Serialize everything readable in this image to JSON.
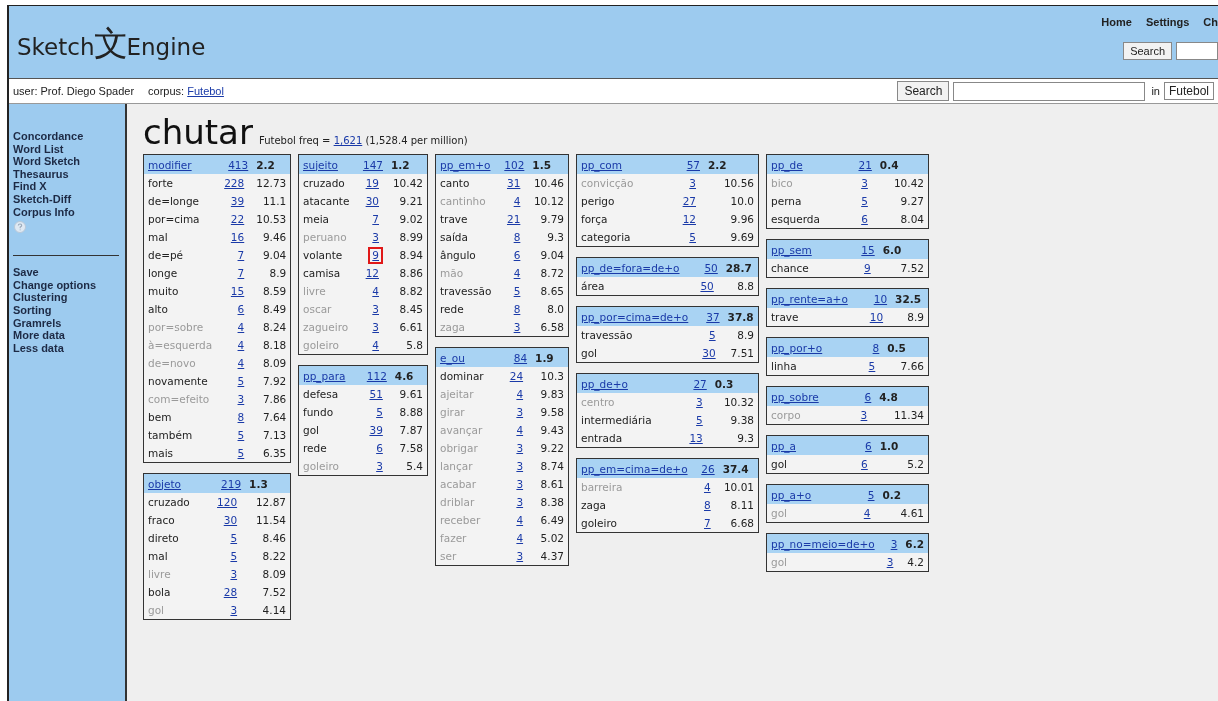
{
  "header": {
    "logo": {
      "left": "Sketch",
      "glyph": "文",
      "right": "Engine"
    },
    "nav_links": [
      "Home",
      "Settings",
      "Ch"
    ],
    "search_button": "Search"
  },
  "user_bar": {
    "user_label": "user:",
    "user": "Prof. Diego Spader",
    "corpus_label": "corpus:",
    "corpus": "Futebol",
    "search_button": "Search",
    "in_label": "in",
    "corpus_select": "Futebol"
  },
  "sidebar": {
    "groups": [
      [
        "Concordance",
        "Word List",
        "Word Sketch",
        "Thesaurus",
        "Find X",
        "Sketch-Diff",
        "Corpus Info"
      ],
      [
        "Save",
        "Change options",
        "Clustering",
        "Sorting",
        "Gramrels",
        "More data",
        "Less data"
      ]
    ]
  },
  "main": {
    "headword": "chutar",
    "freq_prefix": "Futebol freq = ",
    "freq": "1,621",
    "freq_suffix": " (1,528.4 per million)",
    "columns": [
      [
        {
          "relation": "modifier",
          "count": "413",
          "score": "2.2",
          "rows": [
            {
              "word": "forte",
              "count": "228",
              "score": "12.73",
              "dimmed": false,
              "marked": false
            },
            {
              "word": "de=longe",
              "count": "39",
              "score": "11.1",
              "dimmed": false,
              "marked": false
            },
            {
              "word": "por=cima",
              "count": "22",
              "score": "10.53",
              "dimmed": false,
              "marked": false
            },
            {
              "word": "mal",
              "count": "16",
              "score": "9.46",
              "dimmed": false,
              "marked": false
            },
            {
              "word": "de=pé",
              "count": "7",
              "score": "9.04",
              "dimmed": false,
              "marked": false
            },
            {
              "word": "longe",
              "count": "7",
              "score": "8.9",
              "dimmed": false,
              "marked": false
            },
            {
              "word": "muito",
              "count": "15",
              "score": "8.59",
              "dimmed": false,
              "marked": false
            },
            {
              "word": "alto",
              "count": "6",
              "score": "8.49",
              "dimmed": false,
              "marked": false
            },
            {
              "word": "por=sobre",
              "count": "4",
              "score": "8.24",
              "dimmed": true,
              "marked": false
            },
            {
              "word": "à=esquerda",
              "count": "4",
              "score": "8.18",
              "dimmed": true,
              "marked": false
            },
            {
              "word": "de=novo",
              "count": "4",
              "score": "8.09",
              "dimmed": true,
              "marked": false
            },
            {
              "word": "novamente",
              "count": "5",
              "score": "7.92",
              "dimmed": false,
              "marked": false
            },
            {
              "word": "com=efeito",
              "count": "3",
              "score": "7.86",
              "dimmed": true,
              "marked": false
            },
            {
              "word": "bem",
              "count": "8",
              "score": "7.64",
              "dimmed": false,
              "marked": false
            },
            {
              "word": "também",
              "count": "5",
              "score": "7.13",
              "dimmed": false,
              "marked": false
            },
            {
              "word": "mais",
              "count": "5",
              "score": "6.35",
              "dimmed": false,
              "marked": false
            }
          ]
        },
        {
          "relation": "objeto",
          "count": "219",
          "score": "1.3",
          "rows": [
            {
              "word": "cruzado",
              "count": "120",
              "score": "12.87",
              "dimmed": false,
              "marked": false
            },
            {
              "word": "fraco",
              "count": "30",
              "score": "11.54",
              "dimmed": false,
              "marked": false
            },
            {
              "word": "direto",
              "count": "5",
              "score": "8.46",
              "dimmed": false,
              "marked": false
            },
            {
              "word": "mal",
              "count": "5",
              "score": "8.22",
              "dimmed": false,
              "marked": false
            },
            {
              "word": "livre",
              "count": "3",
              "score": "8.09",
              "dimmed": true,
              "marked": false
            },
            {
              "word": "bola",
              "count": "28",
              "score": "7.52",
              "dimmed": false,
              "marked": false
            },
            {
              "word": "gol",
              "count": "3",
              "score": "4.14",
              "dimmed": true,
              "marked": false
            }
          ]
        }
      ],
      [
        {
          "relation": "sujeito",
          "count": "147",
          "score": "1.2",
          "rows": [
            {
              "word": "cruzado",
              "count": "19",
              "score": "10.42",
              "dimmed": false,
              "marked": false
            },
            {
              "word": "atacante",
              "count": "30",
              "score": "9.21",
              "dimmed": false,
              "marked": false
            },
            {
              "word": "meia",
              "count": "7",
              "score": "9.02",
              "dimmed": false,
              "marked": false
            },
            {
              "word": "peruano",
              "count": "3",
              "score": "8.99",
              "dimmed": true,
              "marked": false
            },
            {
              "word": "volante",
              "count": "9",
              "score": "8.94",
              "dimmed": false,
              "marked": true
            },
            {
              "word": "camisa",
              "count": "12",
              "score": "8.86",
              "dimmed": false,
              "marked": false
            },
            {
              "word": "livre",
              "count": "4",
              "score": "8.82",
              "dimmed": true,
              "marked": false
            },
            {
              "word": "oscar",
              "count": "3",
              "score": "8.45",
              "dimmed": true,
              "marked": false
            },
            {
              "word": "zagueiro",
              "count": "3",
              "score": "6.61",
              "dimmed": true,
              "marked": false
            },
            {
              "word": "goleiro",
              "count": "4",
              "score": "5.8",
              "dimmed": true,
              "marked": false
            }
          ]
        },
        {
          "relation": "pp_para",
          "count": "112",
          "score": "4.6",
          "rows": [
            {
              "word": "defesa",
              "count": "51",
              "score": "9.61",
              "dimmed": false,
              "marked": false
            },
            {
              "word": "fundo",
              "count": "5",
              "score": "8.88",
              "dimmed": false,
              "marked": false
            },
            {
              "word": "gol",
              "count": "39",
              "score": "7.87",
              "dimmed": false,
              "marked": false
            },
            {
              "word": "rede",
              "count": "6",
              "score": "7.58",
              "dimmed": false,
              "marked": false
            },
            {
              "word": "goleiro",
              "count": "3",
              "score": "5.4",
              "dimmed": true,
              "marked": false
            }
          ]
        }
      ],
      [
        {
          "relation": "pp_em+o",
          "count": "102",
          "score": "1.5",
          "rows": [
            {
              "word": "canto",
              "count": "31",
              "score": "10.46",
              "dimmed": false,
              "marked": false
            },
            {
              "word": "cantinho",
              "count": "4",
              "score": "10.12",
              "dimmed": true,
              "marked": false
            },
            {
              "word": "trave",
              "count": "21",
              "score": "9.79",
              "dimmed": false,
              "marked": false
            },
            {
              "word": "saída",
              "count": "8",
              "score": "9.3",
              "dimmed": false,
              "marked": false
            },
            {
              "word": "ângulo",
              "count": "6",
              "score": "9.04",
              "dimmed": false,
              "marked": false
            },
            {
              "word": "mão",
              "count": "4",
              "score": "8.72",
              "dimmed": true,
              "marked": false
            },
            {
              "word": "travessão",
              "count": "5",
              "score": "8.65",
              "dimmed": false,
              "marked": false
            },
            {
              "word": "rede",
              "count": "8",
              "score": "8.0",
              "dimmed": false,
              "marked": false
            },
            {
              "word": "zaga",
              "count": "3",
              "score": "6.58",
              "dimmed": true,
              "marked": false
            }
          ]
        },
        {
          "relation": "e_ou",
          "count": "84",
          "score": "1.9",
          "rows": [
            {
              "word": "dominar",
              "count": "24",
              "score": "10.3",
              "dimmed": false,
              "marked": false
            },
            {
              "word": "ajeitar",
              "count": "4",
              "score": "9.83",
              "dimmed": true,
              "marked": false
            },
            {
              "word": "girar",
              "count": "3",
              "score": "9.58",
              "dimmed": true,
              "marked": false
            },
            {
              "word": "avançar",
              "count": "4",
              "score": "9.43",
              "dimmed": true,
              "marked": false
            },
            {
              "word": "obrigar",
              "count": "3",
              "score": "9.22",
              "dimmed": true,
              "marked": false
            },
            {
              "word": "lançar",
              "count": "3",
              "score": "8.74",
              "dimmed": true,
              "marked": false
            },
            {
              "word": "acabar",
              "count": "3",
              "score": "8.61",
              "dimmed": true,
              "marked": false
            },
            {
              "word": "driblar",
              "count": "3",
              "score": "8.38",
              "dimmed": true,
              "marked": false
            },
            {
              "word": "receber",
              "count": "4",
              "score": "6.49",
              "dimmed": true,
              "marked": false
            },
            {
              "word": "fazer",
              "count": "4",
              "score": "5.02",
              "dimmed": true,
              "marked": false
            },
            {
              "word": "ser",
              "count": "3",
              "score": "4.37",
              "dimmed": true,
              "marked": false
            }
          ]
        }
      ],
      [
        {
          "relation": "pp_com",
          "count": "57",
          "score": "2.2",
          "rows": [
            {
              "word": "convicção",
              "count": "3",
              "score": "10.56",
              "dimmed": true,
              "marked": false
            },
            {
              "word": "perigo",
              "count": "27",
              "score": "10.0",
              "dimmed": false,
              "marked": false
            },
            {
              "word": "força",
              "count": "12",
              "score": "9.96",
              "dimmed": false,
              "marked": false
            },
            {
              "word": "categoria",
              "count": "5",
              "score": "9.69",
              "dimmed": false,
              "marked": false
            }
          ]
        },
        {
          "relation": "pp_de=fora=de+o",
          "count": "50",
          "score": "28.7",
          "rows": [
            {
              "word": "área",
              "count": "50",
              "score": "8.8",
              "dimmed": false,
              "marked": false
            }
          ]
        },
        {
          "relation": "pp_por=cima=de+o",
          "count": "37",
          "score": "37.8",
          "rows": [
            {
              "word": "travessão",
              "count": "5",
              "score": "8.9",
              "dimmed": false,
              "marked": false
            },
            {
              "word": "gol",
              "count": "30",
              "score": "7.51",
              "dimmed": false,
              "marked": false
            }
          ]
        },
        {
          "relation": "pp_de+o",
          "count": "27",
          "score": "0.3",
          "rows": [
            {
              "word": "centro",
              "count": "3",
              "score": "10.32",
              "dimmed": true,
              "marked": false
            },
            {
              "word": "intermediária",
              "count": "5",
              "score": "9.38",
              "dimmed": false,
              "marked": false
            },
            {
              "word": "entrada",
              "count": "13",
              "score": "9.3",
              "dimmed": false,
              "marked": false
            }
          ]
        },
        {
          "relation": "pp_em=cima=de+o",
          "count": "26",
          "score": "37.4",
          "rows": [
            {
              "word": "barreira",
              "count": "4",
              "score": "10.01",
              "dimmed": true,
              "marked": false
            },
            {
              "word": "zaga",
              "count": "8",
              "score": "8.11",
              "dimmed": false,
              "marked": false
            },
            {
              "word": "goleiro",
              "count": "7",
              "score": "6.68",
              "dimmed": false,
              "marked": false
            }
          ]
        }
      ],
      [
        {
          "relation": "pp_de",
          "count": "21",
          "score": "0.4",
          "rows": [
            {
              "word": "bico",
              "count": "3",
              "score": "10.42",
              "dimmed": true,
              "marked": false
            },
            {
              "word": "perna",
              "count": "5",
              "score": "9.27",
              "dimmed": false,
              "marked": false
            },
            {
              "word": "esquerda",
              "count": "6",
              "score": "8.04",
              "dimmed": false,
              "marked": false
            }
          ]
        },
        {
          "relation": "pp_sem",
          "count": "15",
          "score": "6.0",
          "rows": [
            {
              "word": "chance",
              "count": "9",
              "score": "7.52",
              "dimmed": false,
              "marked": false
            }
          ]
        },
        {
          "relation": "pp_rente=a+o",
          "count": "10",
          "score": "32.5",
          "rows": [
            {
              "word": "trave",
              "count": "10",
              "score": "8.9",
              "dimmed": false,
              "marked": false
            }
          ]
        },
        {
          "relation": "pp_por+o",
          "count": "8",
          "score": "0.5",
          "rows": [
            {
              "word": "linha",
              "count": "5",
              "score": "7.66",
              "dimmed": false,
              "marked": false
            }
          ]
        },
        {
          "relation": "pp_sobre",
          "count": "6",
          "score": "4.8",
          "rows": [
            {
              "word": "corpo",
              "count": "3",
              "score": "11.34",
              "dimmed": true,
              "marked": false
            }
          ]
        },
        {
          "relation": "pp_a",
          "count": "6",
          "score": "1.0",
          "rows": [
            {
              "word": "gol",
              "count": "6",
              "score": "5.2",
              "dimmed": false,
              "marked": false
            }
          ]
        },
        {
          "relation": "pp_a+o",
          "count": "5",
          "score": "0.2",
          "rows": [
            {
              "word": "gol",
              "count": "4",
              "score": "4.61",
              "dimmed": true,
              "marked": false
            }
          ]
        },
        {
          "relation": "pp_no=meio=de+o",
          "count": "3",
          "score": "6.2",
          "rows": [
            {
              "word": "gol",
              "count": "3",
              "score": "4.2",
              "dimmed": true,
              "marked": false
            }
          ]
        }
      ]
    ]
  }
}
